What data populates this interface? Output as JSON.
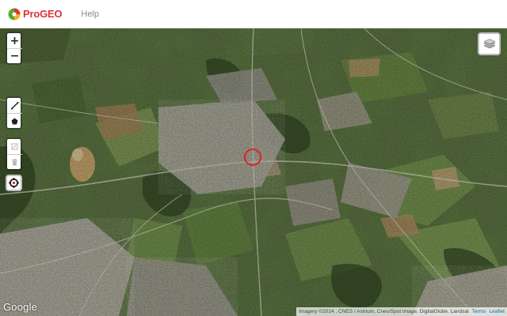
{
  "header": {
    "app_name": "ProGEO",
    "nav_help": "Help"
  },
  "map": {
    "basemap": "satellite",
    "zoom_in_label": "+",
    "zoom_out_label": "−",
    "google_logo_text": "Google",
    "attribution": {
      "imagery": "Imagery ©2014 , CNES / Astrium, Cnes/Spot Image, DigitalGlobe, Landsat",
      "terms": "Terms",
      "leaflet": "Leaflet"
    }
  },
  "toolbar": {
    "draw_line_icon": "draw-polyline-icon",
    "draw_polygon_icon": "draw-polygon-icon",
    "edit_icon": "edit-layers-icon",
    "delete_icon": "delete-layers-icon",
    "locate_icon": "crosshair-icon",
    "layers_icon": "layers-icon"
  },
  "colors": {
    "brand": "#e0323a",
    "marker": "#e32222",
    "link": "#0078a8"
  }
}
